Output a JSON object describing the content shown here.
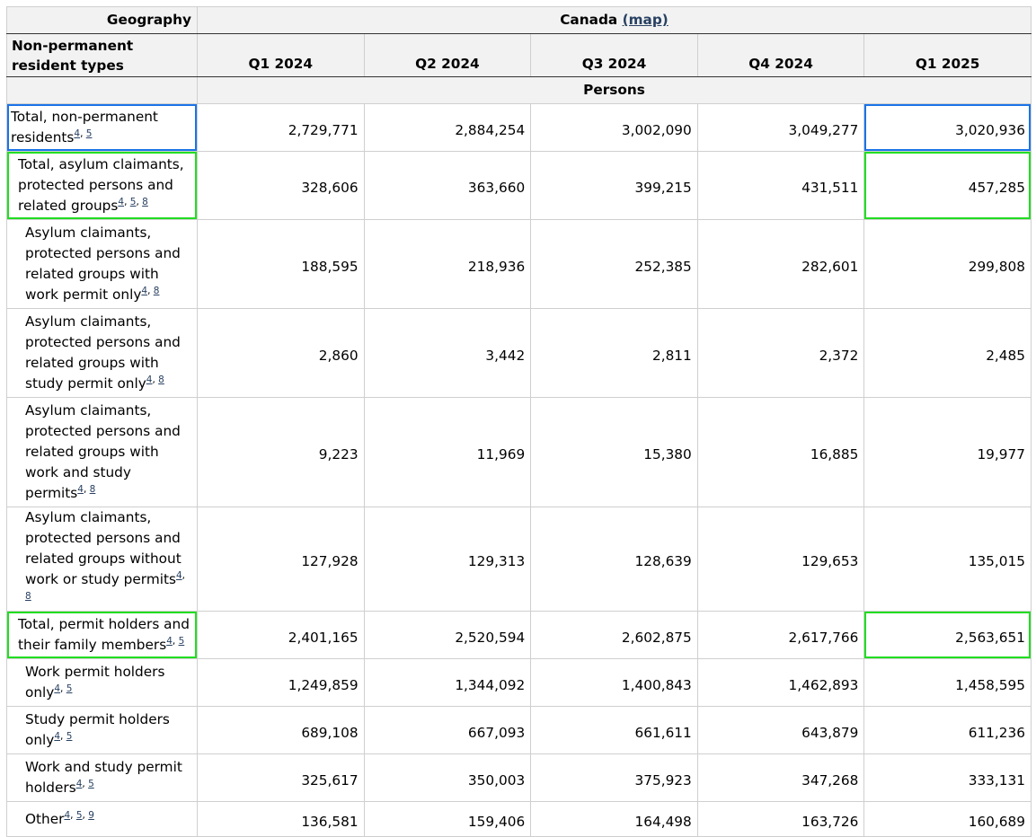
{
  "header": {
    "geography_label": "Geography",
    "geography_value": "Canada",
    "map_link": "(map)",
    "row_header_label": "Non-permanent resident types",
    "periods": [
      "Q1 2024",
      "Q2 2024",
      "Q3 2024",
      "Q4 2024",
      "Q1 2025"
    ],
    "units": "Persons"
  },
  "rows": [
    {
      "label": "Total, non-permanent residents",
      "footnotes": [
        "4",
        "5"
      ],
      "values": [
        "2,729,771",
        "2,884,254",
        "3,002,090",
        "3,049,277",
        "3,020,936"
      ]
    },
    {
      "label": "Total, asylum claimants, protected persons and related groups",
      "footnotes": [
        "4",
        "5",
        "8"
      ],
      "values": [
        "328,606",
        "363,660",
        "399,215",
        "431,511",
        "457,285"
      ]
    },
    {
      "label": "Asylum claimants, protected persons and related groups with work permit only",
      "footnotes": [
        "4",
        "8"
      ],
      "values": [
        "188,595",
        "218,936",
        "252,385",
        "282,601",
        "299,808"
      ]
    },
    {
      "label": "Asylum claimants, protected persons and related groups with study permit only",
      "footnotes": [
        "4",
        "8"
      ],
      "values": [
        "2,860",
        "3,442",
        "2,811",
        "2,372",
        "2,485"
      ]
    },
    {
      "label": "Asylum claimants, protected persons and related groups with work and study permits",
      "footnotes": [
        "4",
        "8"
      ],
      "values": [
        "9,223",
        "11,969",
        "15,380",
        "16,885",
        "19,977"
      ]
    },
    {
      "label": "Asylum claimants, protected persons and related groups without work or study permits",
      "footnotes": [
        "4",
        "8"
      ],
      "values": [
        "127,928",
        "129,313",
        "128,639",
        "129,653",
        "135,015"
      ]
    },
    {
      "label": "Total, permit holders and their family members",
      "footnotes": [
        "4",
        "5"
      ],
      "values": [
        "2,401,165",
        "2,520,594",
        "2,602,875",
        "2,617,766",
        "2,563,651"
      ]
    },
    {
      "label": "Work permit holders only",
      "footnotes": [
        "4",
        "5"
      ],
      "values": [
        "1,249,859",
        "1,344,092",
        "1,400,843",
        "1,462,893",
        "1,458,595"
      ]
    },
    {
      "label": "Study permit holders only",
      "footnotes": [
        "4",
        "5"
      ],
      "values": [
        "689,108",
        "667,093",
        "661,611",
        "643,879",
        "611,236"
      ]
    },
    {
      "label": "Work and study permit holders",
      "footnotes": [
        "4",
        "5"
      ],
      "values": [
        "325,617",
        "350,003",
        "375,923",
        "347,268",
        "333,131"
      ]
    },
    {
      "label": "Other",
      "footnotes": [
        "4",
        "5",
        "9"
      ],
      "values": [
        "136,581",
        "159,406",
        "164,498",
        "163,726",
        "160,689"
      ]
    }
  ],
  "highlight_colors": {
    "blue": "#1a73e8",
    "green": "#22dd22"
  }
}
